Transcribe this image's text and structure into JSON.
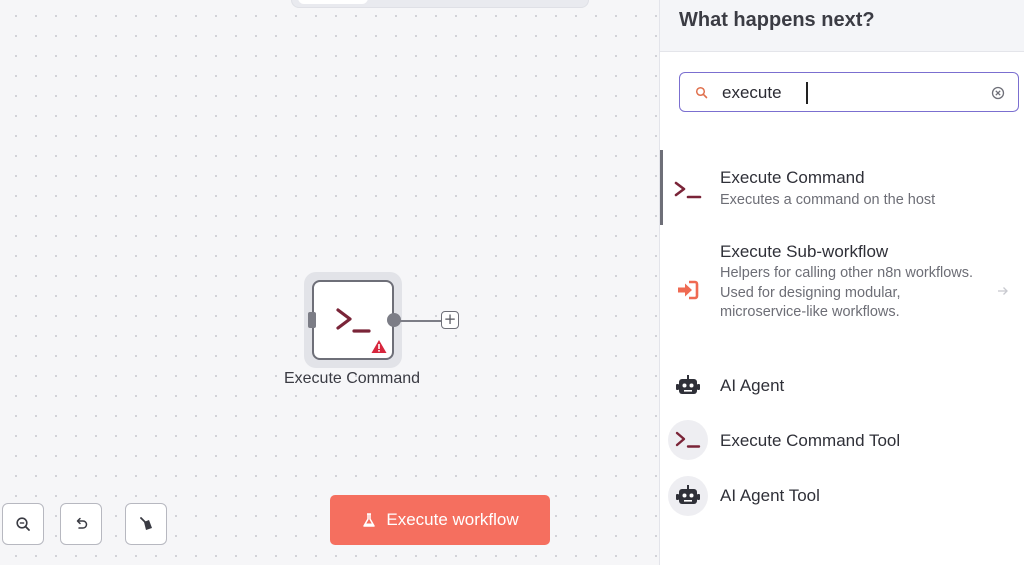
{
  "canvas": {
    "node": {
      "label": "Execute Command",
      "icon": "terminal-icon",
      "badge_icon": "warning-icon",
      "add_icon": "plus-icon"
    },
    "controls": [
      {
        "name": "zoom-out-button",
        "icon": "zoom-out-icon"
      },
      {
        "name": "undo-button",
        "icon": "undo-icon"
      },
      {
        "name": "tidy-button",
        "icon": "broom-icon"
      }
    ],
    "execute_button": {
      "label": "Execute workflow",
      "icon": "flask-icon"
    },
    "accent_color": "#f56f5f"
  },
  "panel": {
    "title": "What happens next?",
    "search": {
      "value": "execute",
      "placeholder": ""
    },
    "results": [
      {
        "name": "Execute Command",
        "description": "Executes a command on the host",
        "icon": "terminal-icon"
      },
      {
        "name": "Execute Sub-workflow",
        "description": "Helpers for calling other n8n workflows. Used for designing modular, microservice-like workflows.",
        "icon": "sign-in-icon",
        "has_arrow": true
      },
      {
        "name": "AI Agent",
        "description": "",
        "icon": "robot-icon"
      },
      {
        "name": "Execute Command Tool",
        "description": "",
        "icon": "terminal-icon"
      },
      {
        "name": "AI Agent Tool",
        "description": "",
        "icon": "robot-icon"
      }
    ],
    "focus_color": "#7b6fd0"
  }
}
